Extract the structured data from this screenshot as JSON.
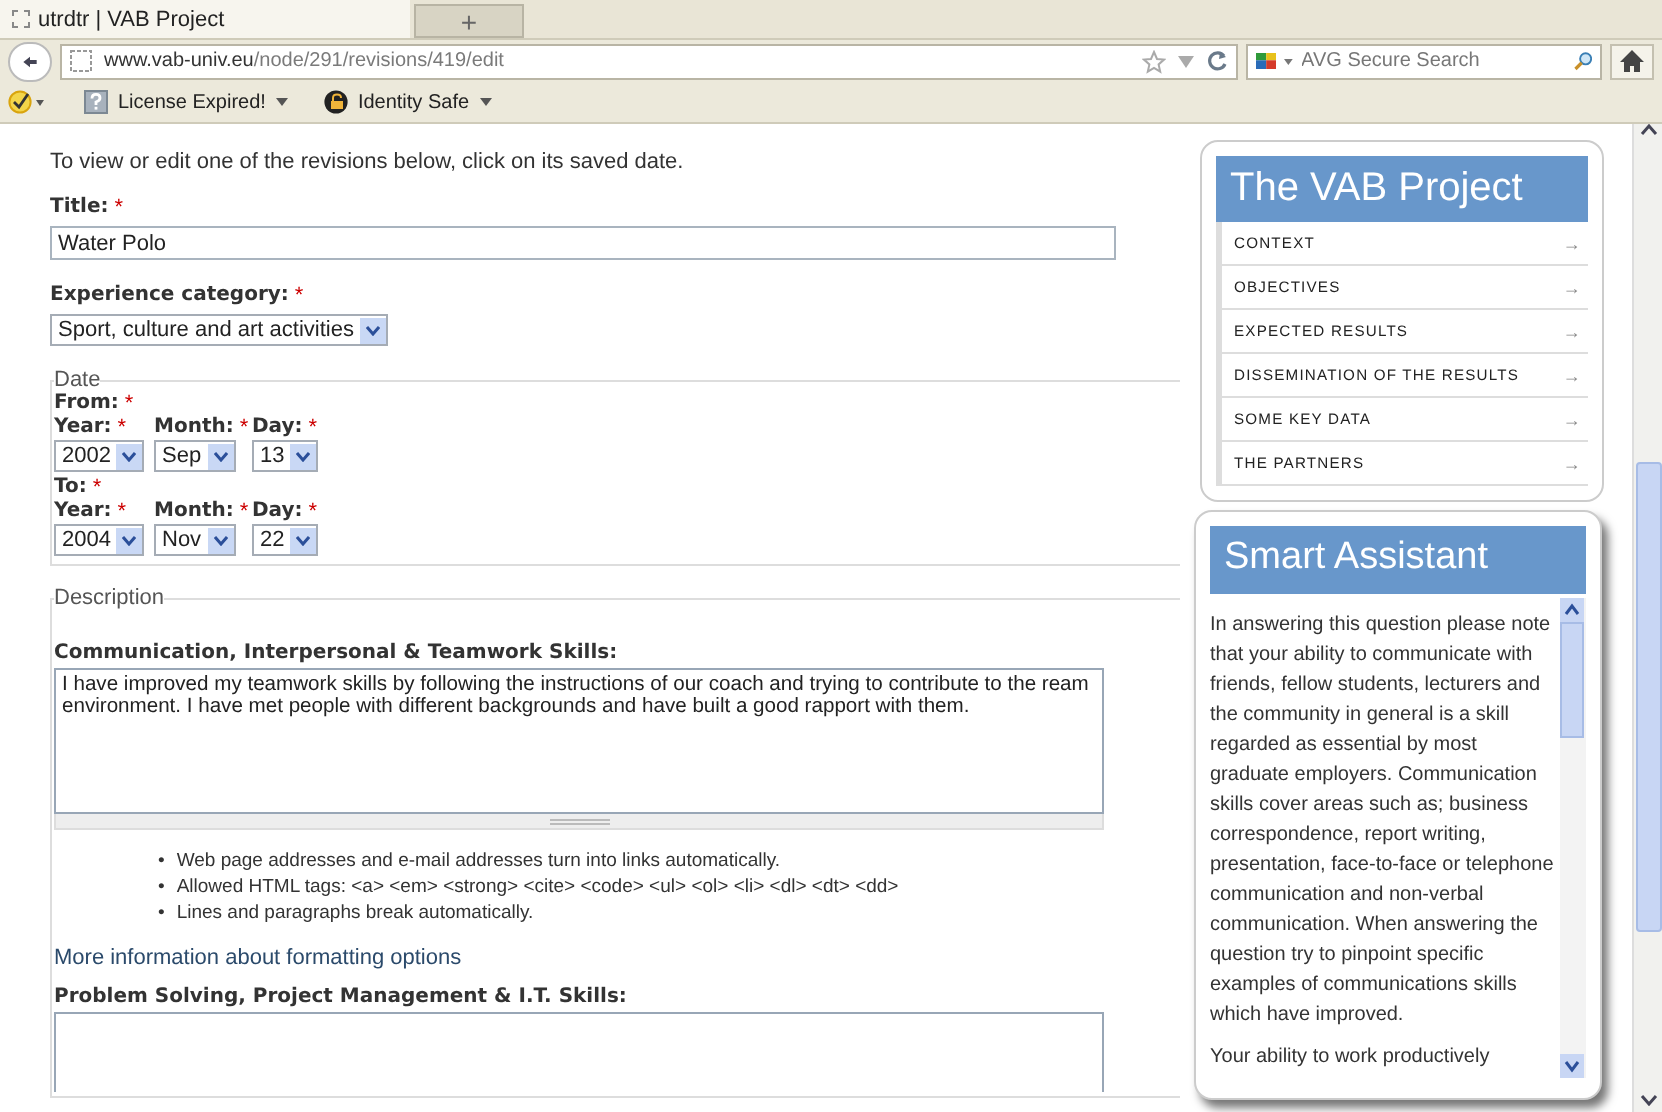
{
  "browser": {
    "tab_title": "utrdtr | VAB Project",
    "new_tab": "+",
    "url_host": "www.vab-univ.eu",
    "url_path": "/node/291/revisions/419/edit",
    "search_placeholder": "AVG Secure Search",
    "bookmarks": [
      {
        "label": "License Expired!",
        "kind": "question"
      },
      {
        "label": "Identity Safe",
        "kind": "lock"
      }
    ]
  },
  "intro": "To view or edit one of the revisions below, click on its saved date.",
  "title_field": {
    "label": "Title:",
    "mark": "*",
    "value": "Water Polo"
  },
  "category": {
    "label": "Experience category:",
    "mark": "*",
    "value": "Sport, culture and art activities"
  },
  "date": {
    "legend": "Date",
    "ranges": [
      {
        "label": "From:",
        "mark": "*",
        "fields": [
          {
            "label": "Year:",
            "mark": "*",
            "value": "2002"
          },
          {
            "label": "Month:",
            "mark": "*",
            "value": "Sep"
          },
          {
            "label": "Day:",
            "mark": "*",
            "value": "13"
          }
        ]
      },
      {
        "label": "To:",
        "mark": "*",
        "fields": [
          {
            "label": "Year:",
            "mark": "*",
            "value": "2004"
          },
          {
            "label": "Month:",
            "mark": "*",
            "value": "Nov"
          },
          {
            "label": "Day:",
            "mark": "*",
            "value": "22"
          }
        ]
      }
    ]
  },
  "description": {
    "legend": "Description",
    "sections": [
      {
        "label": "Communication, Interpersonal & Teamwork Skills:",
        "value": "I have improved my teamwork skills by following the instructions of our coach and trying to contribute to the ream environment. I have met people with different backgrounds and have built a good rapport with them.",
        "tips": [
          {
            "bullet": "•",
            "text": "Web page addresses and e-mail addresses turn into links automatically."
          },
          {
            "bullet": "•",
            "text": "Allowed HTML tags: <a> <em> <strong> <cite> <code> <ul> <ol> <li> <dl> <dt> <dd>"
          },
          {
            "bullet": "•",
            "text": "Lines and paragraphs break automatically."
          }
        ],
        "link": "More information about formatting options"
      },
      {
        "label": "Problem Solving, Project Management & I.T. Skills:"
      }
    ]
  },
  "sidebar": {
    "title": "The VAB Project",
    "items": [
      {
        "label": "CONTEXT",
        "arrow": "→"
      },
      {
        "label": "OBJECTIVES",
        "arrow": "→"
      },
      {
        "label": "EXPECTED RESULTS",
        "arrow": "→"
      },
      {
        "label": "DISSEMINATION OF THE RESULTS",
        "arrow": "→"
      },
      {
        "label": "SOME KEY DATA",
        "arrow": "→"
      },
      {
        "label": "THE PARTNERS",
        "arrow": "→"
      }
    ]
  },
  "assistant": {
    "title": "Smart Assistant",
    "paragraphs": [
      "In answering this question please note that your ability to communicate with friends, fellow students, lecturers and the community in general is a skill regarded as essential by most graduate employers. Communication skills cover areas such as; business correspondence, report writing, presentation, face-to-face or telephone communication and non-verbal communication. When answering the question try to pinpoint specific examples of communications skills which have improved.",
      "Your ability to work productively"
    ]
  }
}
